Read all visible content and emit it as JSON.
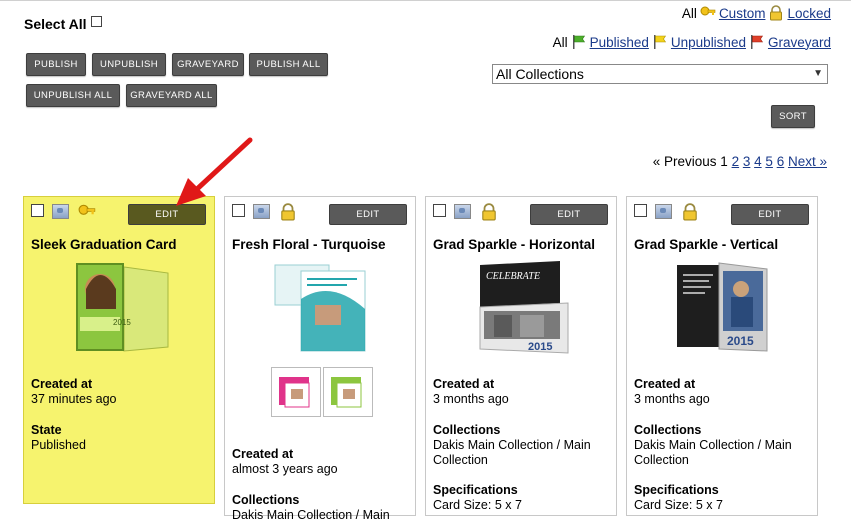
{
  "select_all": {
    "label": "Select All"
  },
  "toolbar": {
    "publish": "PUBLISH",
    "unpublish": "UNPUBLISH",
    "graveyard": "GRAVEYARD",
    "publish_all": "PUBLISH ALL",
    "unpublish_all": "UNPUBLISH ALL",
    "graveyard_all": "GRAVEYARD ALL",
    "sort": "SORT"
  },
  "filters": {
    "row1": {
      "all": "All",
      "custom": "Custom",
      "locked": "Locked"
    },
    "row2": {
      "all": "All",
      "published": "Published",
      "unpublished": "Unpublished",
      "graveyard": "Graveyard"
    }
  },
  "collections_select": {
    "value": "All Collections"
  },
  "pagination": {
    "previous": "« Previous",
    "current": "1",
    "pages": [
      "2",
      "3",
      "4",
      "5",
      "6"
    ],
    "next": "Next »"
  },
  "cards": [
    {
      "title": "Sleek Graduation Card",
      "edit": "EDIT",
      "state_icon": "key-icon",
      "created_label": "Created at",
      "created_value": "37 minutes ago",
      "state_label": "State",
      "state_value": "Published"
    },
    {
      "title": "Fresh Floral - Turquoise",
      "edit": "EDIT",
      "state_icon": "lock-icon",
      "created_label": "Created at",
      "created_value": "almost 3 years ago",
      "collections_label": "Collections",
      "collections_value": "Dakis Main Collection / Main"
    },
    {
      "title": "Grad Sparkle - Horizontal",
      "edit": "EDIT",
      "state_icon": "lock-icon",
      "image_text": "CELEBRATE",
      "image_year": "2015",
      "created_label": "Created at",
      "created_value": "3 months ago",
      "collections_label": "Collections",
      "collections_value_1": "Dakis Main Collection / Main",
      "collections_value_2": "Collection",
      "spec_label": "Specifications",
      "spec_value": "Card Size: 5 x 7"
    },
    {
      "title": "Grad Sparkle - Vertical",
      "edit": "EDIT",
      "state_icon": "lock-icon",
      "image_year": "2015",
      "created_label": "Created at",
      "created_value": "3 months ago",
      "collections_label": "Collections",
      "collections_value_1": "Dakis Main Collection / Main",
      "collections_value_2": "Collection",
      "spec_label": "Specifications",
      "spec_value": "Card Size: 5 x 7"
    }
  ],
  "colors": {
    "highlight": "#f6f36e",
    "button": "#5a5a5a",
    "link": "#1a3a8a",
    "arrow": "#e01818"
  }
}
